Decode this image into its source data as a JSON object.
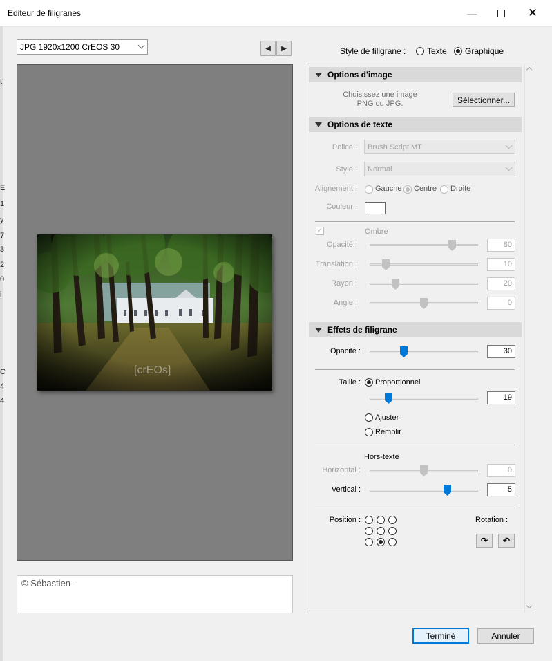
{
  "window": {
    "title": "Editeur de filigranes"
  },
  "preset": {
    "selected": "JPG 1920x1200 CrEOS 30"
  },
  "nav": {
    "prev": "◀",
    "next": "▶"
  },
  "style_selector": {
    "label": "Style de filigrane :",
    "options": [
      "Texte",
      "Graphique"
    ],
    "selected": "Graphique"
  },
  "copyright_text": "© Sébastien -",
  "photo_watermark": "[crEOs]",
  "image_options": {
    "header": "Options d'image",
    "hint_line1": "Choisissez une image",
    "hint_line2": "PNG ou JPG.",
    "select_button": "Sélectionner..."
  },
  "text_options": {
    "header": "Options de texte",
    "font_label": "Police :",
    "font_value": "Brush Script MT",
    "style_label": "Style :",
    "style_value": "Normal",
    "align_label": "Alignement :",
    "align_options": [
      "Gauche",
      "Centre",
      "Droite"
    ],
    "align_selected": "Centre",
    "color_label": "Couleur :",
    "shadow_label": "Ombre",
    "shadow_sliders": [
      {
        "label": "Opacité :",
        "value": "80",
        "fraction": 0.78
      },
      {
        "label": "Translation :",
        "value": "10",
        "fraction": 0.12
      },
      {
        "label": "Rayon :",
        "value": "20",
        "fraction": 0.22
      },
      {
        "label": "Angle :",
        "value": "0",
        "fraction": 0.5
      }
    ]
  },
  "watermark_effects": {
    "header": "Effets de filigrane",
    "opacity_label": "Opacité :",
    "opacity_value": "30",
    "opacity_fraction": 0.3,
    "size_label": "Taille :",
    "size_options": [
      "Proportionnel",
      "Ajuster",
      "Remplir"
    ],
    "size_selected": "Proportionnel",
    "size_value": "19",
    "size_fraction": 0.15,
    "offset_title": "Hors-texte",
    "horizontal_label": "Horizontal :",
    "horizontal_value": "0",
    "horizontal_fraction": 0.5,
    "vertical_label": "Vertical :",
    "vertical_value": "5",
    "vertical_fraction": 0.73,
    "position_label": "Position :",
    "position_selected": "bottom-center",
    "rotation_label": "Rotation :",
    "rotate_cw": "↷",
    "rotate_ccw": "↶"
  },
  "buttons": {
    "done": "Terminé",
    "cancel": "Annuler"
  },
  "background_letters": [
    "t",
    "E",
    "1",
    "y",
    "7",
    "3",
    "2",
    "0",
    "l",
    "C",
    "4",
    "4"
  ],
  "colors": {
    "accent": "#0078d7",
    "panel_header": "#d9d9d9",
    "preview_bg": "#7f7f7f"
  }
}
